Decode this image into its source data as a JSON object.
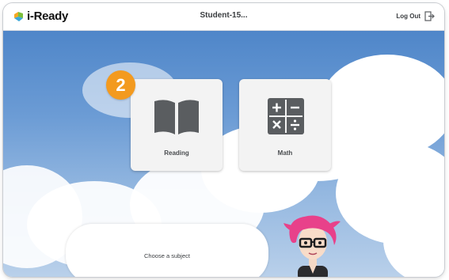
{
  "header": {
    "logo_text": "i-Ready",
    "student_name": "Student-15...",
    "logout_label": "Log Out"
  },
  "subjects": [
    {
      "label": "Reading",
      "icon": "open-book-icon"
    },
    {
      "label": "Math",
      "icon": "calculator-icon"
    }
  ],
  "step_badge": "2",
  "prompt": {
    "text": "Choose a subject"
  },
  "colors": {
    "badge": "#f39a1f",
    "card": "#f3f3f3",
    "icon": "#5a5d60",
    "sky_top": "#4f86c9"
  }
}
